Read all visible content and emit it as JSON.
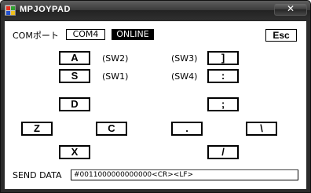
{
  "window": {
    "title": "MPJOYPAD",
    "close_glyph": "✕"
  },
  "com": {
    "label": "COMポート",
    "port": "COM4",
    "status": "ONLINE",
    "esc_label": "Esc"
  },
  "buttons": {
    "a": "A",
    "s": "S",
    "d": "D",
    "z": "Z",
    "c": "C",
    "x": "X",
    "bracket": "]",
    "colon": ":",
    "semicolon": ";",
    "period": ".",
    "backslash": "\\",
    "slash": "/"
  },
  "switch_labels": {
    "sw2": "(SW2)",
    "sw1": "(SW1)",
    "sw3": "(SW3)",
    "sw4": "(SW4)"
  },
  "send": {
    "label": "SEND DATA",
    "value": "#0011000000000000<CR><LF>"
  }
}
